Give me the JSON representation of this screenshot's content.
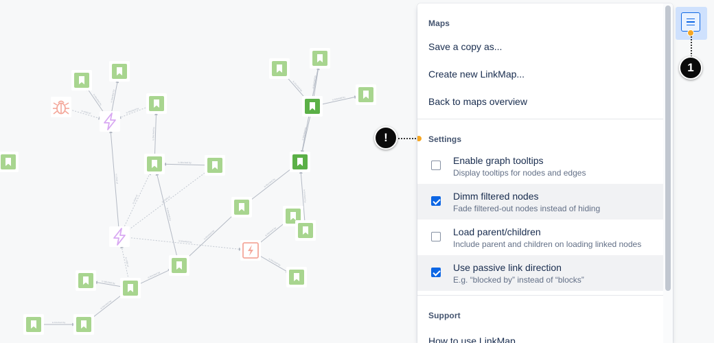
{
  "graph": {
    "node_types": {
      "story": {
        "icon": "bookmark-icon",
        "color": "#a8d58f"
      },
      "story_selected": {
        "icon": "bookmark-icon",
        "color": "#5bb047"
      },
      "epic": {
        "icon": "lightning-icon",
        "color": "#d8a8f2"
      },
      "bug": {
        "icon": "bug-icon",
        "color": "#f4a79a"
      },
      "incident": {
        "icon": "incident-icon",
        "color": "#f4a79a"
      }
    },
    "edge_labels": {
      "is_blocked_by": "is blocked by",
      "is_child_of": "is child of"
    }
  },
  "menu": {
    "maps_section": {
      "title": "Maps",
      "items": [
        "Save a copy as...",
        "Create new LinkMap...",
        "Back to maps overview"
      ]
    },
    "settings_section": {
      "title": "Settings",
      "options": [
        {
          "title": "Enable graph tooltips",
          "description": "Display tooltips for nodes and edges",
          "checked": false
        },
        {
          "title": "Dimm filtered nodes",
          "description": "Fade filtered-out nodes instead of hiding",
          "checked": true
        },
        {
          "title": "Load parent/children",
          "description": "Include parent and children on loading linked nodes",
          "checked": false
        },
        {
          "title": "Use passive link direction",
          "description": "E.g. “blocked by” instead of “blocks”",
          "checked": true
        }
      ]
    },
    "support_section": {
      "title": "Support",
      "partial_item": "How to use LinkMap"
    }
  },
  "toolbar": {
    "menu_button_icon": "hamburger-menu-icon"
  },
  "callouts": {
    "step_number": "1",
    "warning": "!"
  },
  "colors": {
    "accent": "#0c66e4",
    "callout_dot": "#f5a623",
    "badge": "#0b0b0b"
  }
}
